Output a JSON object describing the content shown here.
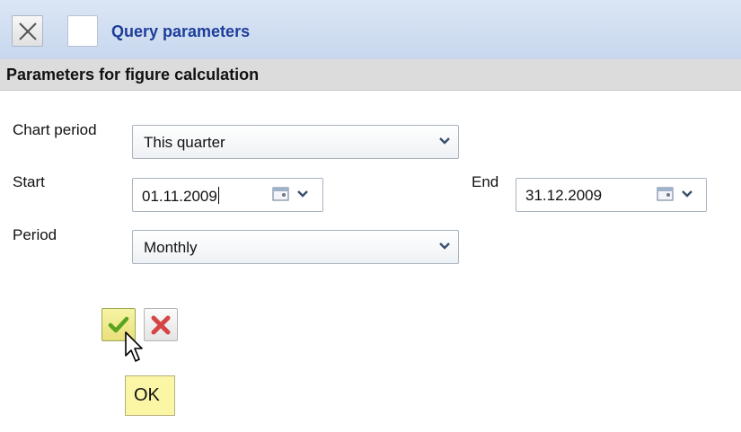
{
  "header": {
    "title": "Query parameters"
  },
  "section": {
    "title": "Parameters for figure calculation"
  },
  "form": {
    "chart_period_label": "Chart period",
    "chart_period_value": "This quarter",
    "start_label": "Start",
    "start_value": "01.11.2009",
    "end_label": "End",
    "end_value": "31.12.2009",
    "period_label": "Period",
    "period_value": "Monthly"
  },
  "tooltip": {
    "text": "OK"
  },
  "colors": {
    "title_blue": "#1d3d9a",
    "header_bg": "#c8d7ee",
    "section_bg": "#dcdcdc",
    "tooltip_bg": "#fbf6a6"
  },
  "icons": {
    "close": "close-icon",
    "calendar": "calendar-icon",
    "dropdown": "chevron-down-icon",
    "ok": "checkmark-icon",
    "cancel": "x-icon",
    "cursor": "mouse-pointer-icon"
  }
}
